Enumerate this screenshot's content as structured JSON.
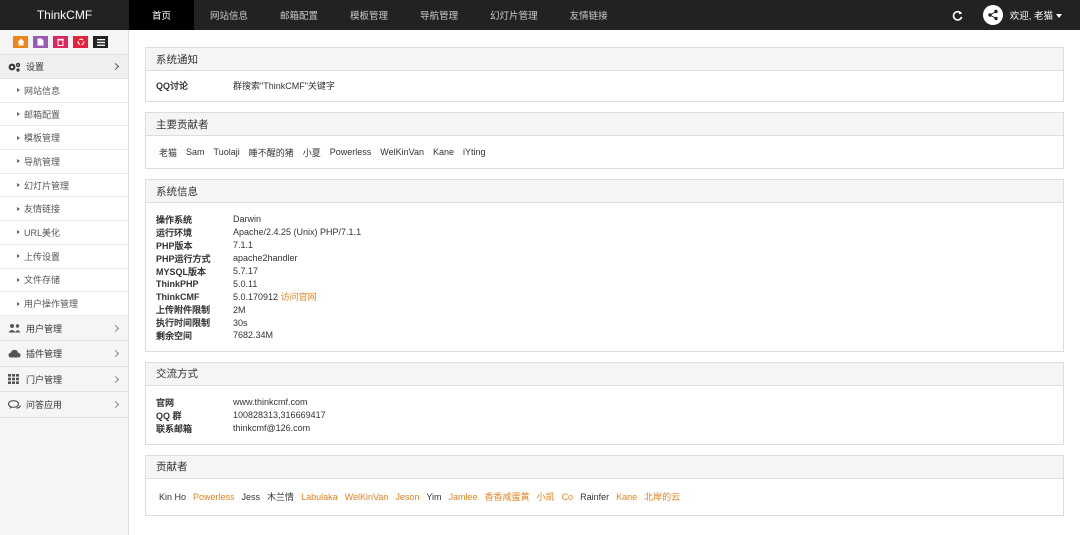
{
  "brand": "ThinkCMF",
  "nav": [
    "首页",
    "网站信息",
    "邮箱配置",
    "模板管理",
    "导航管理",
    "幻灯片管理",
    "友情链接"
  ],
  "welcome": "欢迎, 老猫",
  "sidebar": {
    "settings_label": "设置",
    "sub_items": [
      "网站信息",
      "邮箱配置",
      "模板管理",
      "导航管理",
      "幻灯片管理",
      "友情链接",
      "URL美化",
      "上传设置",
      "文件存储",
      "用户操作管理"
    ],
    "groups": [
      "用户管理",
      "插件管理",
      "门户管理",
      "问答应用"
    ]
  },
  "notice": {
    "title": "系统通知",
    "key": "QQ讨论",
    "value": "群搜索\"ThinkCMF\"关键字"
  },
  "main_contributors": {
    "title": "主要贡献者",
    "names": [
      "老猫",
      "Sam",
      "Tuolaji",
      "睡不醒的猪",
      "小夏",
      "Powerless",
      "WelKinVan",
      "Kane",
      "iYting"
    ]
  },
  "sysinfo": {
    "title": "系统信息",
    "rows": [
      {
        "k": "操作系统",
        "v": "Darwin"
      },
      {
        "k": "运行环境",
        "v": "Apache/2.4.25 (Unix) PHP/7.1.1"
      },
      {
        "k": "PHP版本",
        "v": "7.1.1"
      },
      {
        "k": "PHP运行方式",
        "v": "apache2handler"
      },
      {
        "k": "MYSQL版本",
        "v": "5.7.17"
      },
      {
        "k": "ThinkPHP",
        "v": "5.0.11"
      },
      {
        "k": "ThinkCMF",
        "v": "5.0.170912",
        "link": "访问官网"
      },
      {
        "k": "上传附件限制",
        "v": "2M"
      },
      {
        "k": "执行时间限制",
        "v": "30s"
      },
      {
        "k": "剩余空间",
        "v": "7682.34M"
      }
    ]
  },
  "contact": {
    "title": "交流方式",
    "rows": [
      {
        "k": "官网",
        "v": "www.thinkcmf.com",
        "link": true
      },
      {
        "k": "QQ 群",
        "v": "100828313,316669417"
      },
      {
        "k": "联系邮箱",
        "v": "thinkcmf@126.com"
      }
    ]
  },
  "contributors": {
    "title": "贡献者",
    "names": [
      {
        "n": "Kin Ho",
        "link": false
      },
      {
        "n": "Powerless",
        "link": true
      },
      {
        "n": "Jess",
        "link": false
      },
      {
        "n": "木兰情",
        "link": false
      },
      {
        "n": "Labulaka",
        "link": true
      },
      {
        "n": "WelKinVan",
        "link": true
      },
      {
        "n": "Jeson",
        "link": true
      },
      {
        "n": "Yim",
        "link": false
      },
      {
        "n": "Jamlee",
        "link": true
      },
      {
        "n": "香香咸蛋黄",
        "link": true
      },
      {
        "n": "小凯",
        "link": true
      },
      {
        "n": "Co",
        "link": true
      },
      {
        "n": "Rainfer",
        "link": false
      },
      {
        "n": "Kane",
        "link": true
      },
      {
        "n": "北岸的云",
        "link": true
      }
    ]
  },
  "colors": {
    "topbar": "#222222",
    "link": "#e8821e",
    "shortcut_home": "#f0851c",
    "shortcut_file": "#9b59b6",
    "shortcut_trash": "#e0245e",
    "shortcut_recycle": "#e8213a",
    "shortcut_list": "#222222"
  }
}
